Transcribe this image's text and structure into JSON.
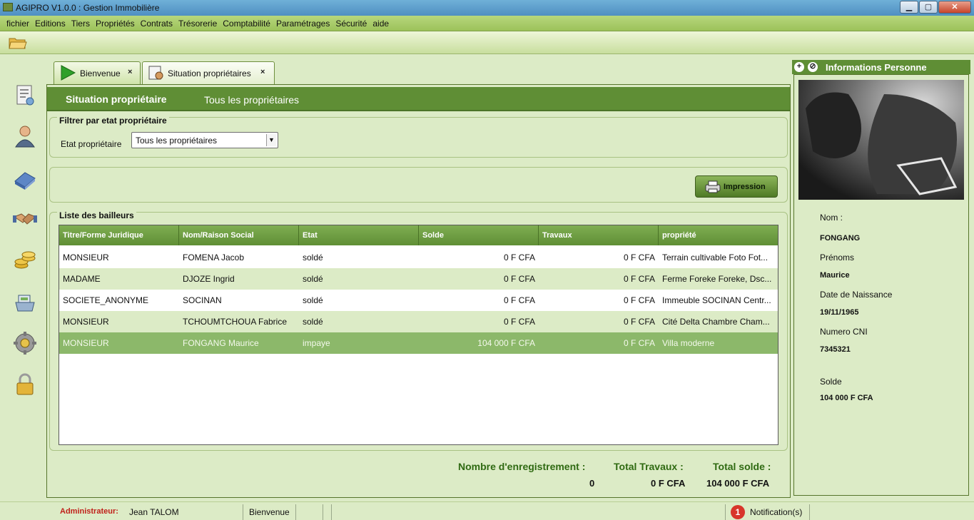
{
  "window": {
    "title": "AGIPRO V1.0.0 : Gestion Immobilière",
    "min": "▁",
    "max": "▢",
    "close": "✕"
  },
  "menu": [
    "fichier",
    "Editions",
    "Tiers",
    "Propriétés",
    "Contrats",
    "Trésorerie",
    "Comptabilité",
    "Paramétrages",
    "Sécurité",
    "aide"
  ],
  "toolbar": {
    "open_icon": "folder-open-icon"
  },
  "sidebar_icons": [
    "contract-icon",
    "user-icon",
    "building-icon",
    "handshake-icon",
    "coins-icon",
    "cash-register-icon",
    "gear-icon",
    "padlock-icon"
  ],
  "tabs": [
    {
      "label": "Bienvenue",
      "close": "×"
    },
    {
      "label": "Situation propriétaires",
      "close": "×"
    }
  ],
  "subtabs": {
    "active": "Situation propriétaire",
    "second": "Tous les propriétaires"
  },
  "filter": {
    "legend": "Filtrer par etat propriétaire",
    "label": "Etat propriétaire",
    "selected": "Tous les propriétaires"
  },
  "print_button": "Impression",
  "list": {
    "legend": "Liste des bailleurs",
    "columns": [
      "Titre/Forme Juridique",
      "Nom/Raison Social",
      "Etat",
      "Solde",
      "Travaux",
      "propriété"
    ],
    "rows": [
      [
        "MONSIEUR",
        "FOMENA Jacob",
        "soldé",
        "0 F CFA",
        "0 F CFA",
        "Terrain cultivable Foto Fot..."
      ],
      [
        "MADAME",
        "DJOZE Ingrid",
        "soldé",
        "0 F CFA",
        "0 F CFA",
        "Ferme Foreke Foreke, Dsc..."
      ],
      [
        "SOCIETE_ANONYME",
        "SOCINAN",
        "soldé",
        "0 F CFA",
        "0 F CFA",
        "Immeuble SOCINAN Centr..."
      ],
      [
        "MONSIEUR",
        "TCHOUMTCHOUA Fabrice",
        "soldé",
        "0 F CFA",
        "0 F CFA",
        "Cité Delta  Chambre Cham..."
      ],
      [
        "MONSIEUR",
        "FONGANG Maurice",
        "impaye",
        "104 000 F CFA",
        "0 F CFA",
        "Villa moderne"
      ]
    ],
    "selected_row": 4
  },
  "totals": {
    "count_label": "Nombre d'enregistrement :",
    "count": "0",
    "travaux_label": "Total Travaux :",
    "travaux": "0 F CFA",
    "solde_label": "Total solde :",
    "solde": "104 000 F CFA"
  },
  "person": {
    "header": "Informations Personne",
    "nom_label": "Nom :",
    "nom": "FONGANG",
    "prenoms_label": "Prénoms",
    "prenoms": "Maurice",
    "naissance_label": "Date de Naissance",
    "naissance": "19/11/1965",
    "cni_label": "Numero CNI",
    "cni": "7345321",
    "solde_label": "Solde",
    "solde": "104 000 F CFA"
  },
  "status": {
    "role": "Administrateur:",
    "user": "Jean TALOM",
    "view": "Bienvenue",
    "notif_count": "1",
    "notif_label": "Notification(s)"
  },
  "colors": {
    "accent": "#5f8e35",
    "selected_row": "#8cb86a",
    "total_label": "#2f6a12",
    "badge": "#d8352a"
  }
}
